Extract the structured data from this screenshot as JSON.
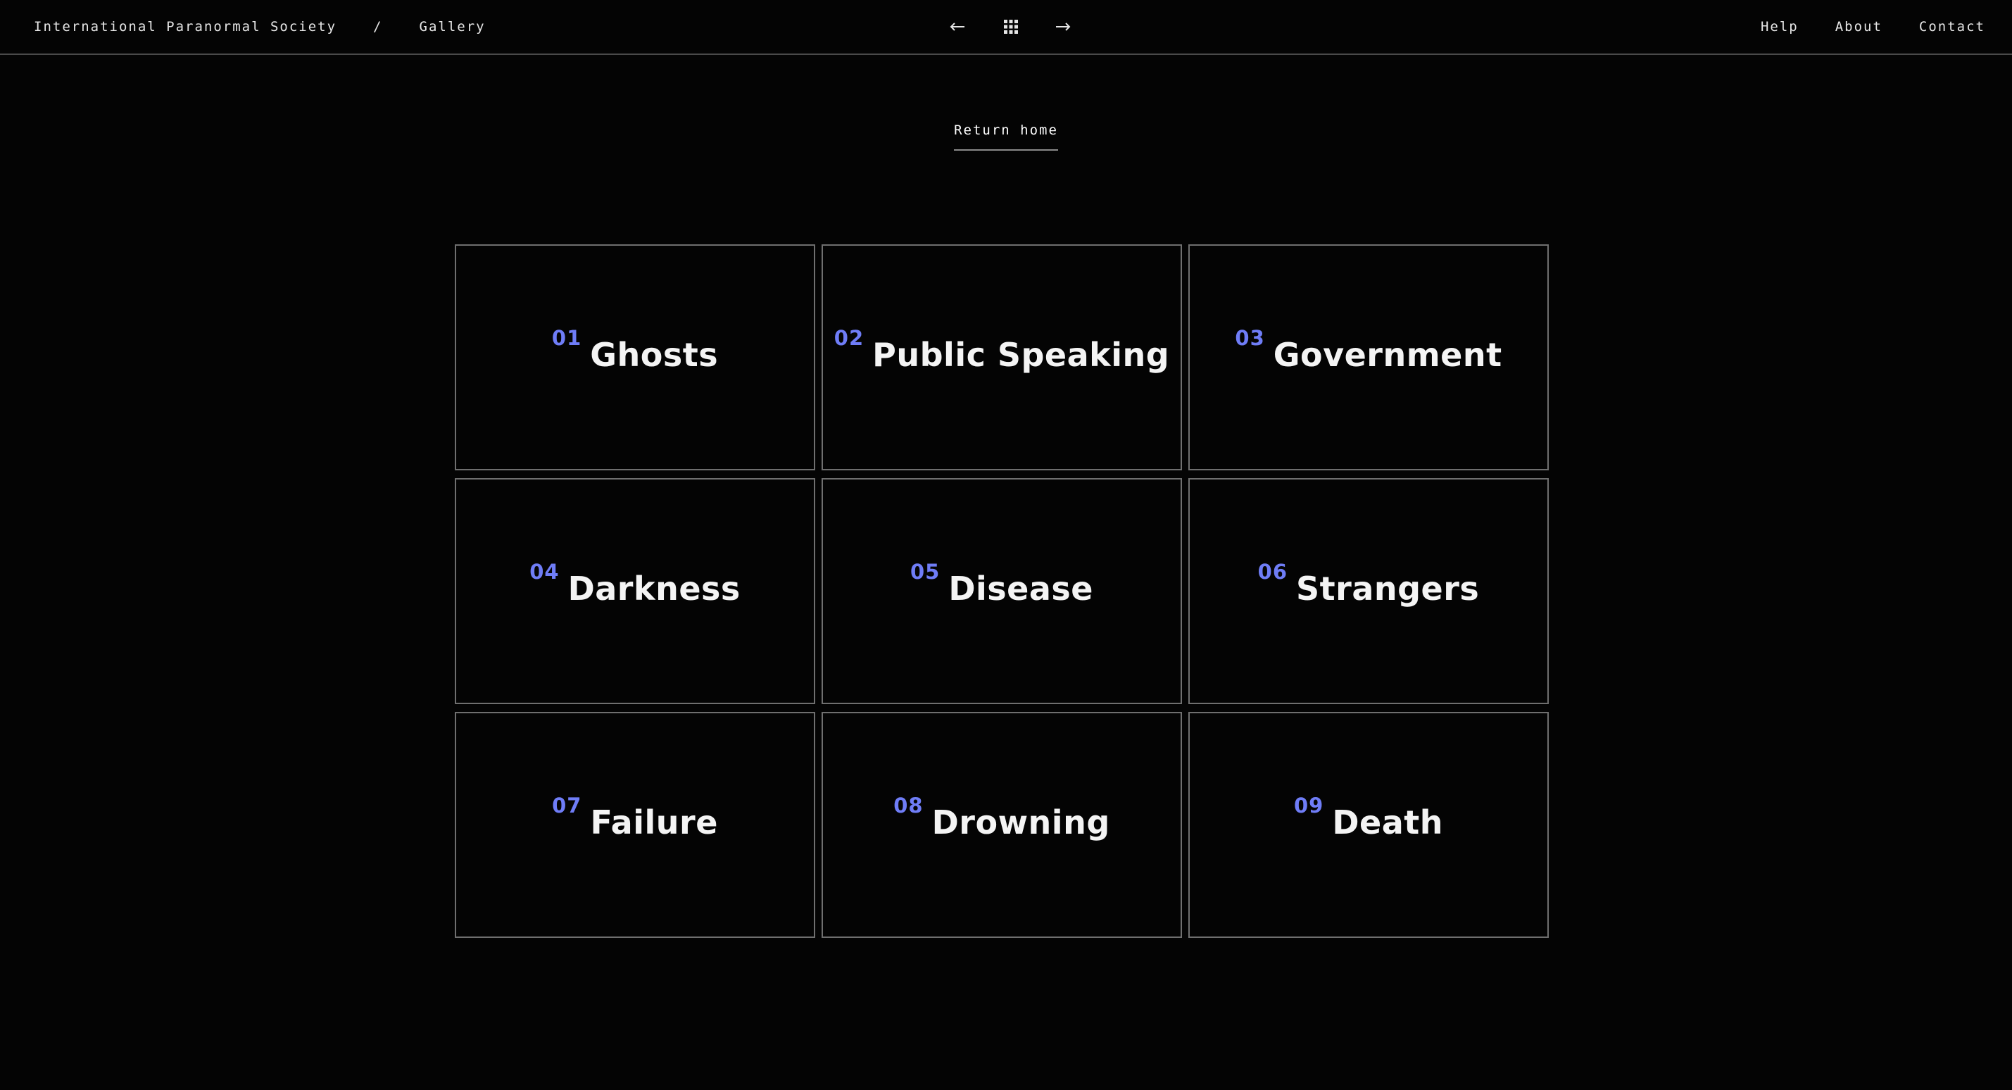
{
  "header": {
    "site_name": "International Paranormal Society",
    "separator": "/",
    "section": "Gallery",
    "nav": {
      "help": "Help",
      "about": "About",
      "contact": "Contact"
    },
    "controls": {
      "prev_icon": "arrow-left-icon",
      "grid_icon": "grid-icon",
      "next_icon": "arrow-right-icon"
    }
  },
  "return_home": "Return home",
  "colors": {
    "background": "#040404",
    "accent": "#6f7df7",
    "border": "#6f6f6f"
  },
  "gallery": [
    {
      "number": "01",
      "title": "Ghosts"
    },
    {
      "number": "02",
      "title": "Public Speaking"
    },
    {
      "number": "03",
      "title": "Government"
    },
    {
      "number": "04",
      "title": "Darkness"
    },
    {
      "number": "05",
      "title": "Disease"
    },
    {
      "number": "06",
      "title": "Strangers"
    },
    {
      "number": "07",
      "title": "Failure"
    },
    {
      "number": "08",
      "title": "Drowning"
    },
    {
      "number": "09",
      "title": "Death"
    }
  ]
}
